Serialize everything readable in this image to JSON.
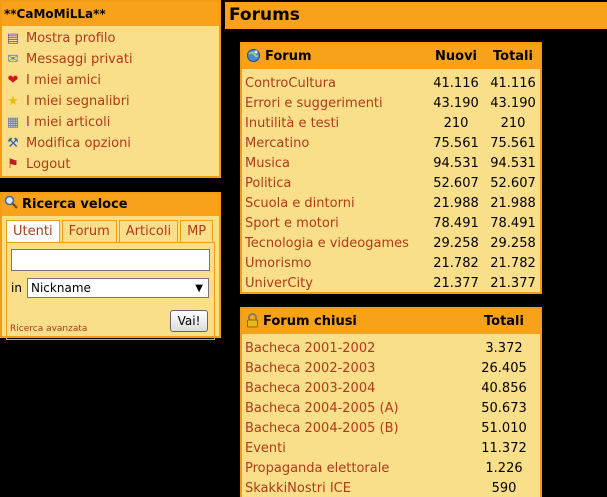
{
  "user_panel": {
    "username": "**CaMoMiLLa**",
    "menu": [
      {
        "label": "Mostra profilo",
        "icon": "profile-card-icon",
        "glyph": "▤",
        "color": "#7a4a9a"
      },
      {
        "label": "Messaggi privati",
        "icon": "envelope-icon",
        "glyph": "✉",
        "color": "#5a7ab0"
      },
      {
        "label": "I miei amici",
        "icon": "heart-icon",
        "glyph": "❤",
        "color": "#d01818"
      },
      {
        "label": "I miei segnalibri",
        "icon": "star-icon",
        "glyph": "★",
        "color": "#e8c000"
      },
      {
        "label": "I miei articoli",
        "icon": "documents-icon",
        "glyph": "▦",
        "color": "#5a7ab0"
      },
      {
        "label": "Modifica opzioni",
        "icon": "wrench-icon",
        "glyph": "⚒",
        "color": "#3060b0"
      },
      {
        "label": "Logout",
        "icon": "logout-flag-icon",
        "glyph": "⚑",
        "color": "#c02020"
      }
    ]
  },
  "search_panel": {
    "title": "Ricerca veloce",
    "tabs": [
      "Utenti",
      "Forum",
      "Articoli",
      "MP"
    ],
    "active_tab": "Utenti",
    "query_value": "",
    "in_label": "in",
    "field_selected": "Nickname",
    "advanced_link": "Ricerca avanzata",
    "submit_label": "Vai!"
  },
  "page_title": "Forums",
  "open_forums": {
    "header": {
      "name": "Forum",
      "new": "Nuovi",
      "total": "Totali"
    },
    "rows": [
      {
        "name": "ControCultura",
        "new": "41.116",
        "total": "41.116"
      },
      {
        "name": "Errori e suggerimenti",
        "new": "43.190",
        "total": "43.190"
      },
      {
        "name": "Inutilità e testi",
        "new": "210",
        "total": "210"
      },
      {
        "name": "Mercatino",
        "new": "75.561",
        "total": "75.561"
      },
      {
        "name": "Musica",
        "new": "94.531",
        "total": "94.531"
      },
      {
        "name": "Politica",
        "new": "52.607",
        "total": "52.607"
      },
      {
        "name": "Scuola e dintorni",
        "new": "21.988",
        "total": "21.988"
      },
      {
        "name": "Sport e motori",
        "new": "78.491",
        "total": "78.491"
      },
      {
        "name": "Tecnologia e videogames",
        "new": "29.258",
        "total": "29.258"
      },
      {
        "name": "Umorismo",
        "new": "21.782",
        "total": "21.782"
      },
      {
        "name": "UniverCity",
        "new": "21.377",
        "total": "21.377"
      }
    ]
  },
  "closed_forums": {
    "header": {
      "name": "Forum chiusi",
      "total": "Totali"
    },
    "rows": [
      {
        "name": "Bacheca 2001-2002",
        "total": "3.372"
      },
      {
        "name": "Bacheca 2002-2003",
        "total": "26.405"
      },
      {
        "name": "Bacheca 2003-2004",
        "total": "40.856"
      },
      {
        "name": "Bacheca 2004-2005 (A)",
        "total": "50.673"
      },
      {
        "name": "Bacheca 2004-2005 (B)",
        "total": "51.010"
      },
      {
        "name": "Eventi",
        "total": "11.372"
      },
      {
        "name": "Propaganda elettorale",
        "total": "1.226"
      },
      {
        "name": "SkakkiNostri ICE",
        "total": "590"
      }
    ]
  }
}
